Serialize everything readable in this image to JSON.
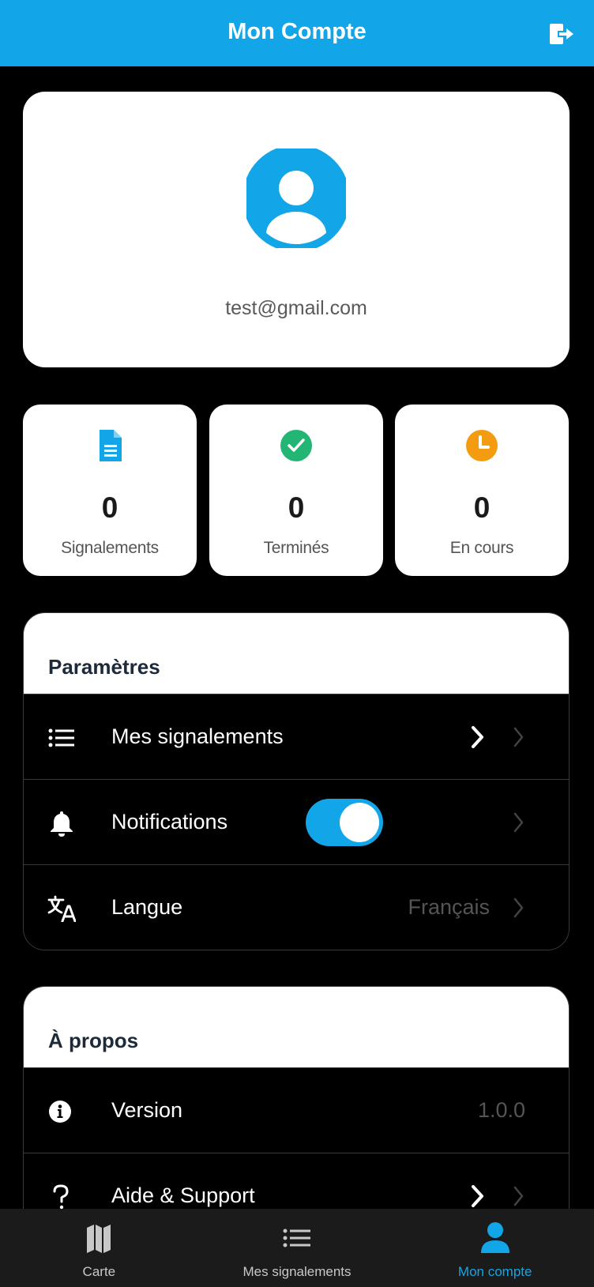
{
  "header": {
    "title": "Mon Compte",
    "logout_icon": "logout-icon"
  },
  "profile": {
    "email": "test@gmail.com",
    "avatar_icon": "user-avatar-icon"
  },
  "stats": [
    {
      "icon": "document-icon",
      "color": "#12a6e8",
      "value": "0",
      "label": "Signalements"
    },
    {
      "icon": "check-circle-icon",
      "color": "#22b573",
      "value": "0",
      "label": "Terminés"
    },
    {
      "icon": "clock-icon",
      "color": "#f39c12",
      "value": "0",
      "label": "En cours"
    }
  ],
  "settings": {
    "title": "Paramètres",
    "items": [
      {
        "icon": "list-icon",
        "label": "Mes signalements"
      },
      {
        "icon": "bell-icon",
        "label": "Notifications",
        "toggle_on": true
      },
      {
        "icon": "translate-icon",
        "label": "Langue",
        "value": "Français"
      }
    ]
  },
  "about": {
    "title": "À propos",
    "items": [
      {
        "icon": "info-icon",
        "label": "Version",
        "value": "1.0.0"
      },
      {
        "icon": "help-icon",
        "label": "Aide & Support"
      }
    ]
  },
  "tabbar": {
    "items": [
      {
        "icon": "map-icon",
        "label": "Carte"
      },
      {
        "icon": "list-icon",
        "label": "Mes signalements"
      },
      {
        "icon": "person-icon",
        "label": "Mon compte",
        "active": true
      }
    ]
  },
  "colors": {
    "accent": "#12a6e8",
    "success": "#22b573",
    "warning": "#f39c12"
  }
}
